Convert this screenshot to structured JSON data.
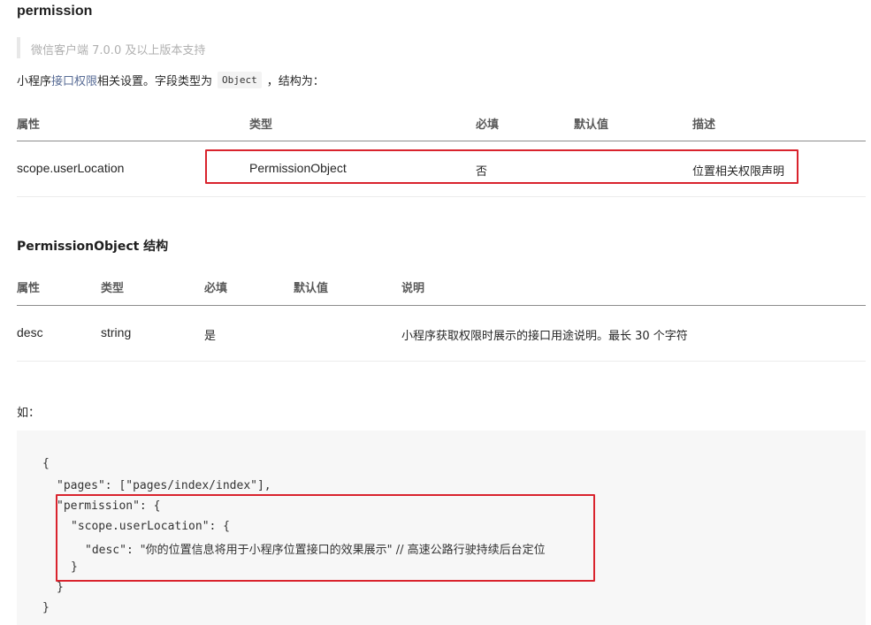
{
  "heading": "permission",
  "version_note": "微信客户端 7.0.0 及以上版本支持",
  "intro": {
    "prefix": "小程序",
    "link": "接口权限",
    "middle": "相关设置。字段类型为",
    "code": "Object",
    "suffix": "，结构为："
  },
  "table1": {
    "headers": [
      "属性",
      "类型",
      "必填",
      "默认值",
      "描述"
    ],
    "row": {
      "attr": "scope.userLocation",
      "type": "PermissionObject",
      "required": "否",
      "default": "",
      "desc": "位置相关权限声明"
    }
  },
  "section2_title": "PermissionObject 结构",
  "table2": {
    "headers": [
      "属性",
      "类型",
      "必填",
      "默认值",
      "说明"
    ],
    "row": {
      "attr": "desc",
      "type": "string",
      "required": "是",
      "default": "",
      "desc": "小程序获取权限时展示的接口用途说明。最长 30 个字符"
    }
  },
  "example_label": "如：",
  "code": {
    "l1": "{",
    "l2": "\"pages\": [\"pages/index/index\"],",
    "l3": "\"permission\": {",
    "l4": "\"scope.userLocation\": {",
    "l5_key": "\"desc\": ",
    "l5_val": "\"你的位置信息将用于小程序位置接口的效果展示\"",
    "l5_comment": " // 高速公路行驶持续后台定位",
    "l6": "}",
    "l7": "}",
    "l8": "}"
  },
  "accent_colors": {
    "highlight_box": "#d9232d",
    "link": "#576b95"
  }
}
